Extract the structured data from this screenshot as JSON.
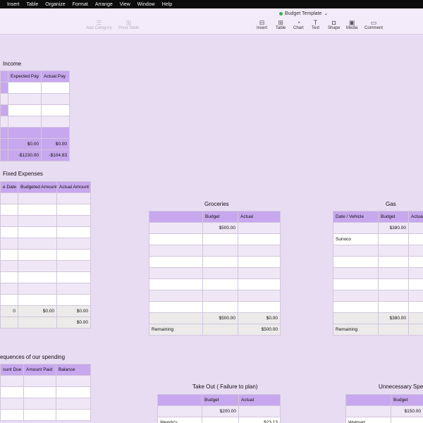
{
  "menu": [
    "Insert",
    "Table",
    "Organize",
    "Format",
    "Arrange",
    "View",
    "Window",
    "Help"
  ],
  "doc_title": "Budget Template",
  "toolbar_left": [
    {
      "label": "Add Category",
      "icon": "add-category-icon",
      "glyph": "☰"
    },
    {
      "label": "Pivot Table",
      "icon": "pivot-table-icon",
      "glyph": "⊞"
    }
  ],
  "toolbar_right": [
    {
      "label": "Insert",
      "icon": "insert-icon",
      "glyph": "⊟"
    },
    {
      "label": "Table",
      "icon": "table-icon",
      "glyph": "⊞"
    },
    {
      "label": "Chart",
      "icon": "chart-icon",
      "glyph": "◔"
    },
    {
      "label": "Text",
      "icon": "text-icon",
      "glyph": "T"
    },
    {
      "label": "Shape",
      "icon": "shape-icon",
      "glyph": "◘"
    },
    {
      "label": "Media",
      "icon": "media-icon",
      "glyph": "▣"
    },
    {
      "label": "Comment",
      "icon": "comment-icon",
      "glyph": "▭"
    }
  ],
  "income": {
    "title": "Income",
    "headers": [
      "Expected Pay",
      "Actual Pay"
    ],
    "total": [
      "$0.00",
      "$0.00"
    ],
    "difference": [
      "-$1230.00",
      "-$104.83"
    ]
  },
  "fixed": {
    "title": "Fixed Expenses",
    "headers": [
      "e Date",
      "Budgeted Amount",
      "Actual Amount"
    ],
    "total": [
      "0",
      "$0.00",
      "$0.00"
    ],
    "sub": "$0.00"
  },
  "groceries": {
    "title": "Groceries",
    "headers": [
      "Budget",
      "Actual"
    ],
    "budget_value": "$500.00",
    "total": [
      "$500.00",
      "$0.00"
    ],
    "remaining_label": "Remaining",
    "remaining_value": "$500.00"
  },
  "gas": {
    "title": "Gas",
    "headers": [
      "Date / Vehicle",
      "Budget",
      "Actual"
    ],
    "budget_value": "$380.00",
    "row_label": "Sunoco",
    "total": "$380.00",
    "remaining_label": "Remaining"
  },
  "consequences": {
    "title": "equences of our spending",
    "headers": [
      "ount Due",
      "Amount Paid",
      "Balance"
    ]
  },
  "takeout": {
    "title": "Take Out ( Failure to plan)",
    "headers": [
      "Budget",
      "Actual"
    ],
    "budget_value": "$200.00",
    "row_label": "Wendy's",
    "actual_value": "$23.13"
  },
  "unnecessary": {
    "title": "Unnecessary Spendin",
    "headers": [
      "Budget"
    ],
    "budget_value": "$150.00",
    "row_label": "Walmart"
  }
}
